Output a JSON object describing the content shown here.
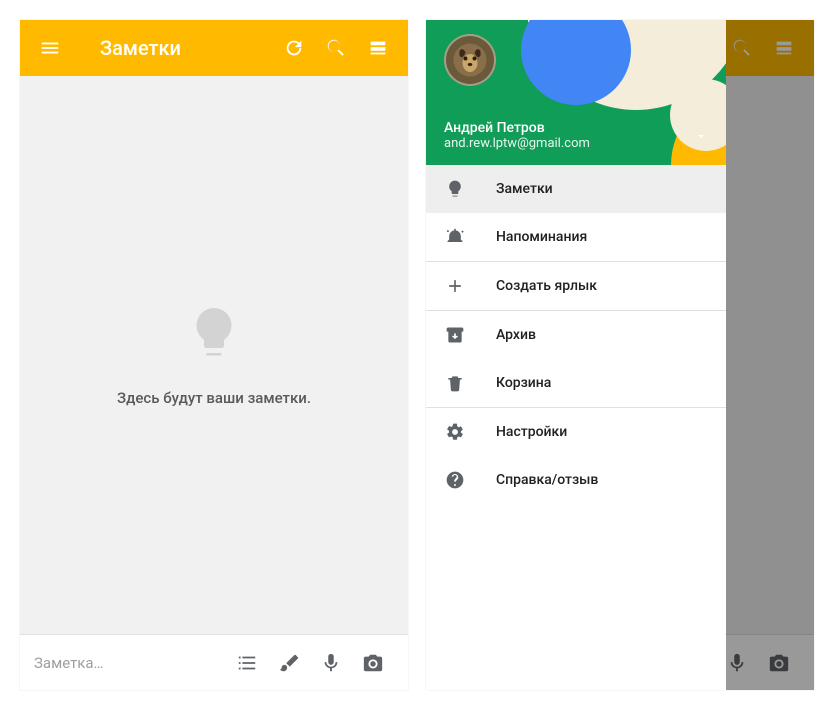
{
  "colors": {
    "accent": "#ffba00",
    "drawer_green": "#0f9d58",
    "drawer_orange": "#ffba00",
    "drawer_blue": "#4285f4",
    "drawer_cream": "#f5f5dc"
  },
  "left": {
    "title": "Заметки",
    "empty_message": "Здесь будут ваши заметки.",
    "new_note_placeholder": "Заметка…"
  },
  "right": {
    "title": "Заметки",
    "account": {
      "name": "Андрей Петров",
      "email": "and.rew.lptw@gmail.com"
    },
    "drawer_items": [
      {
        "id": "notes",
        "label": "Заметки",
        "icon": "bulb-icon",
        "selected": true
      },
      {
        "id": "reminders",
        "label": "Напоминания",
        "icon": "reminder-icon",
        "selected": false
      },
      {
        "id": "create_label",
        "label": "Создать ярлык",
        "icon": "plus-icon",
        "selected": false
      },
      {
        "id": "archive",
        "label": "Архив",
        "icon": "archive-icon",
        "selected": false
      },
      {
        "id": "trash",
        "label": "Корзина",
        "icon": "trash-icon",
        "selected": false
      },
      {
        "id": "settings",
        "label": "Настройки",
        "icon": "gear-icon",
        "selected": false
      },
      {
        "id": "help",
        "label": "Справка/отзыв",
        "icon": "help-icon",
        "selected": false
      }
    ]
  }
}
